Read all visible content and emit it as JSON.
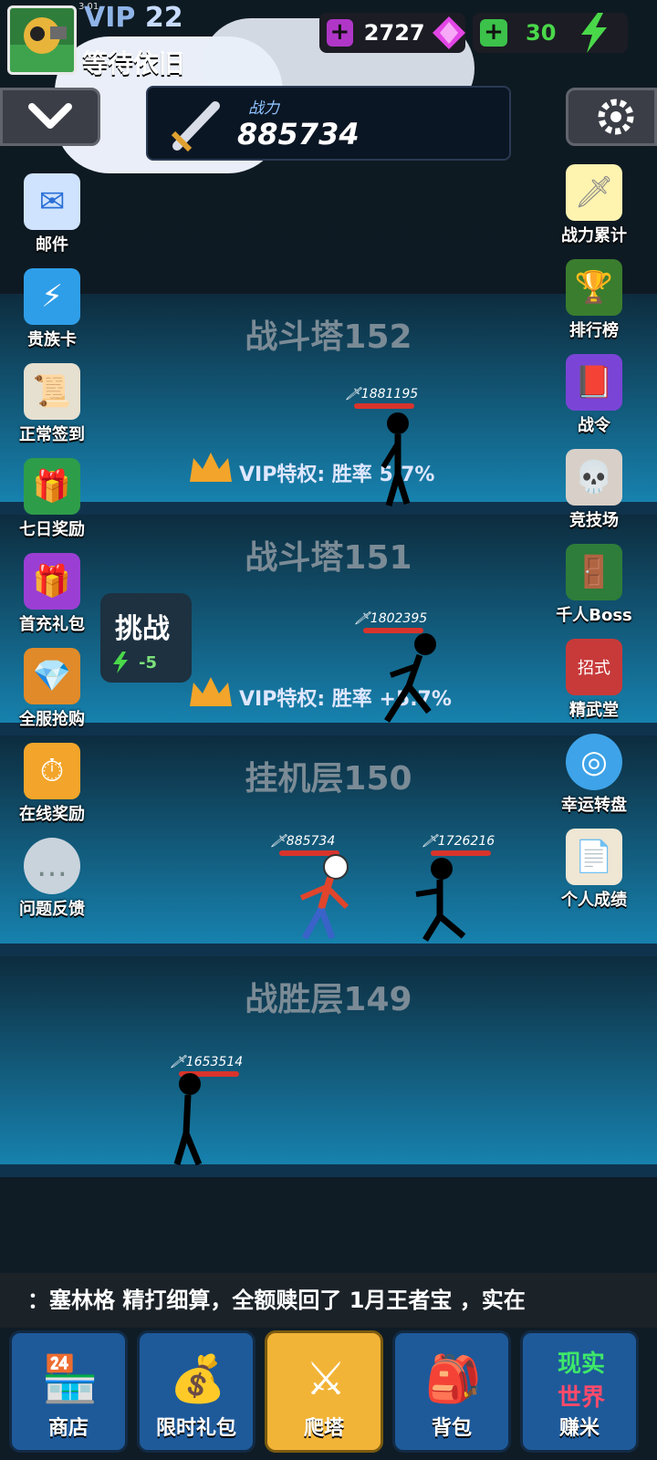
{
  "status": {
    "time": "3.01"
  },
  "player": {
    "vip_label": "VIP",
    "vip_level": "22",
    "name": "等待依旧"
  },
  "resources": {
    "gems": "2727",
    "energy": "30"
  },
  "power": {
    "label": "战力",
    "value": "885734"
  },
  "floors": [
    {
      "title": "战斗塔152",
      "vip": "VIP特权: 胜率 5.7%",
      "enemy_power": "1881195"
    },
    {
      "title": "战斗塔151",
      "vip": "VIP特权: 胜率 +5.7%",
      "enemy_power": "1802395"
    },
    {
      "title": "挂机层150",
      "player_power": "885734",
      "enemy_power": "1726216"
    },
    {
      "title": "战胜层149",
      "enemy_power": "1653514"
    }
  ],
  "challenge": {
    "label": "挑战",
    "cost": "-5"
  },
  "left_icons": [
    "邮件",
    "贵族卡",
    "正常签到",
    "七日奖励",
    "首充礼包",
    "全服抢购",
    "在线奖励",
    "问题反馈"
  ],
  "right_icons": [
    "战力累计",
    "排行榜",
    "战令",
    "竞技场",
    "千人Boss",
    "精武堂",
    "幸运转盘",
    "个人成绩"
  ],
  "ticker": "：塞林格 精打细算，全额赎回了 1月王者宝 ，实在",
  "nav": [
    "商店",
    "限时礼包",
    "爬塔",
    "背包",
    "赚米"
  ],
  "nav_badge": [
    "现实",
    "世界"
  ],
  "colors": {
    "gem": "#d63bd9",
    "energy": "#4ad84a",
    "active_tab": "#f2b437",
    "tab": "#1e5a9a"
  }
}
